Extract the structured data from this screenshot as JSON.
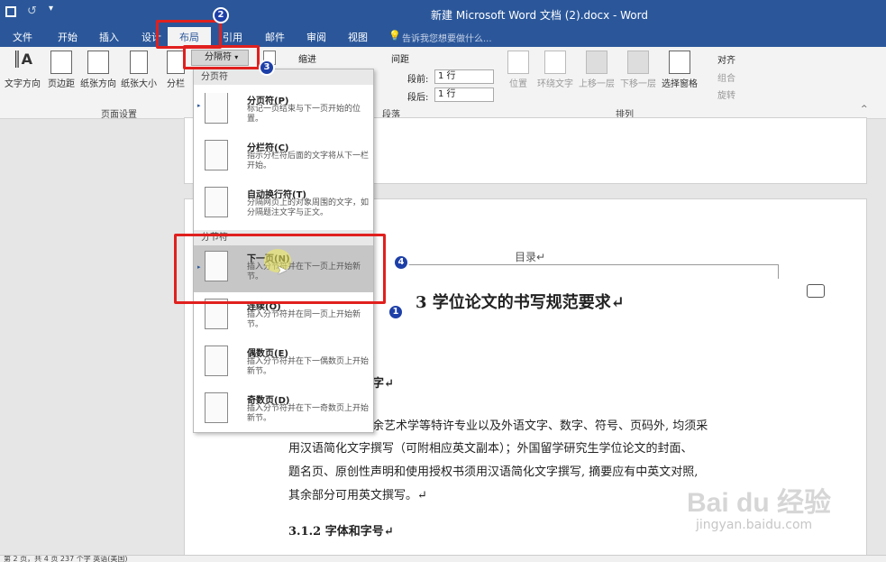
{
  "window": {
    "title": "新建 Microsoft Word 文档 (2).docx - Word"
  },
  "qat": {
    "save_icon": "save-icon",
    "undo_icon": "undo-icon"
  },
  "tabs": [
    {
      "label": "文件"
    },
    {
      "label": "开始"
    },
    {
      "label": "插入"
    },
    {
      "label": "设计"
    },
    {
      "label": "布局"
    },
    {
      "label": "引用"
    },
    {
      "label": "邮件"
    },
    {
      "label": "审阅"
    },
    {
      "label": "视图"
    }
  ],
  "tellme": {
    "placeholder": "告诉我您想要做什么..."
  },
  "ribbon": {
    "page_setup": {
      "text_direction": "文字方向",
      "margins": "页边距",
      "orientation": "纸张方向",
      "size": "纸张大小",
      "columns": "分栏",
      "breaks": "分隔符",
      "group_label": "页面设置"
    },
    "paragraph": {
      "indent_label": "缩进",
      "spacing_label": "间距",
      "before_label": "段前:",
      "before_value": "1 行",
      "after_label": "段后:",
      "after_value": "1 行",
      "group_label": "段落"
    },
    "arrange": {
      "position": "位置",
      "wrap_text": "环绕文字",
      "bring_forward": "上移一层",
      "send_backward": "下移一层",
      "selection_pane": "选择窗格",
      "align": "对齐",
      "group": "组合",
      "rotate": "旋转",
      "group_label": "排列"
    }
  },
  "menu": {
    "section_page_breaks": "分页符",
    "section_section_breaks": "分节符",
    "items": [
      {
        "title": "分页符(P)",
        "desc": "标记一页结束与下一页开始的位置。"
      },
      {
        "title": "分栏符(C)",
        "desc": "指示分栏符后面的文字将从下一栏开始。"
      },
      {
        "title": "自动换行符(T)",
        "desc": "分隔网页上的对象周围的文字，如分隔题注文字与正文。"
      },
      {
        "title": "下一页(N)",
        "desc": "插入分节符并在下一页上开始新节。"
      },
      {
        "title": "连续(O)",
        "desc": "插入分节符并在同一页上开始新节。"
      },
      {
        "title": "偶数页(E)",
        "desc": "插入分节符并在下一偶数页上开始新节。"
      },
      {
        "title": "奇数页(D)",
        "desc": "插入分节符并在下一奇数页上开始新节。"
      }
    ]
  },
  "document": {
    "header_text": "目录↵",
    "heading": "3 学位论文的书写规范要求↵",
    "sub_fragment": "字↵",
    "para_line1": "余艺术学等特许专业以及外语文字、数字、符号、页码外, 均须采",
    "para_line2": "用汉语简化文字撰写（可附相应英文副本）；外国留学研究生学位论文的封面、",
    "para_line3": "题名页、原创性声明和使用授权书须用汉语简化文字撰写, 摘要应有中英文对照,",
    "para_line4": "其余部分可用英文撰写。↵",
    "sub_heading": "3.1.2 字体和字号↵"
  },
  "annotations": {
    "n1": "1",
    "n2": "2",
    "n3": "3",
    "n4": "4"
  },
  "watermark": {
    "brand": "Bai du 经验",
    "url": "jingyan.baidu.com"
  },
  "statusbar": {
    "left": "第 2 页，共 4 页    237 个字    英语(美国)"
  }
}
